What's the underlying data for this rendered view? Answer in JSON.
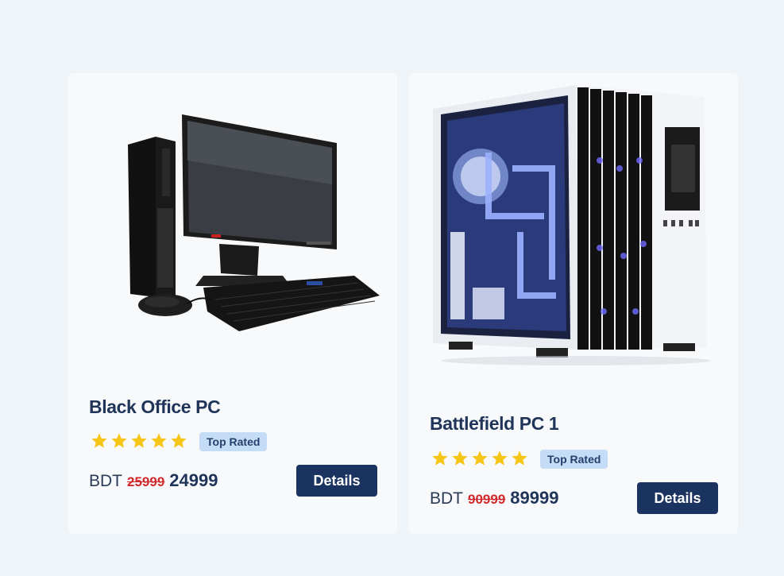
{
  "products": [
    {
      "name": "Black Office PC",
      "image": "office-pc-image",
      "rating": 5,
      "badge": "Top Rated",
      "currency": "BDT",
      "old_price": "25999",
      "new_price": "24999",
      "details_label": "Details"
    },
    {
      "name": "Battlefield PC 1",
      "image": "gaming-pc-image",
      "rating": 5,
      "badge": "Top Rated",
      "currency": "BDT",
      "old_price": "90999",
      "new_price": "89999",
      "details_label": "Details"
    }
  ],
  "colors": {
    "page_bg": "#eff4f8",
    "card_bg": "#f7f9fb",
    "title": "#1f3458",
    "star": "#f5c518",
    "badge_bg": "#c5dcf6",
    "old_price": "#d22a2a",
    "button_bg": "#1b3360"
  }
}
